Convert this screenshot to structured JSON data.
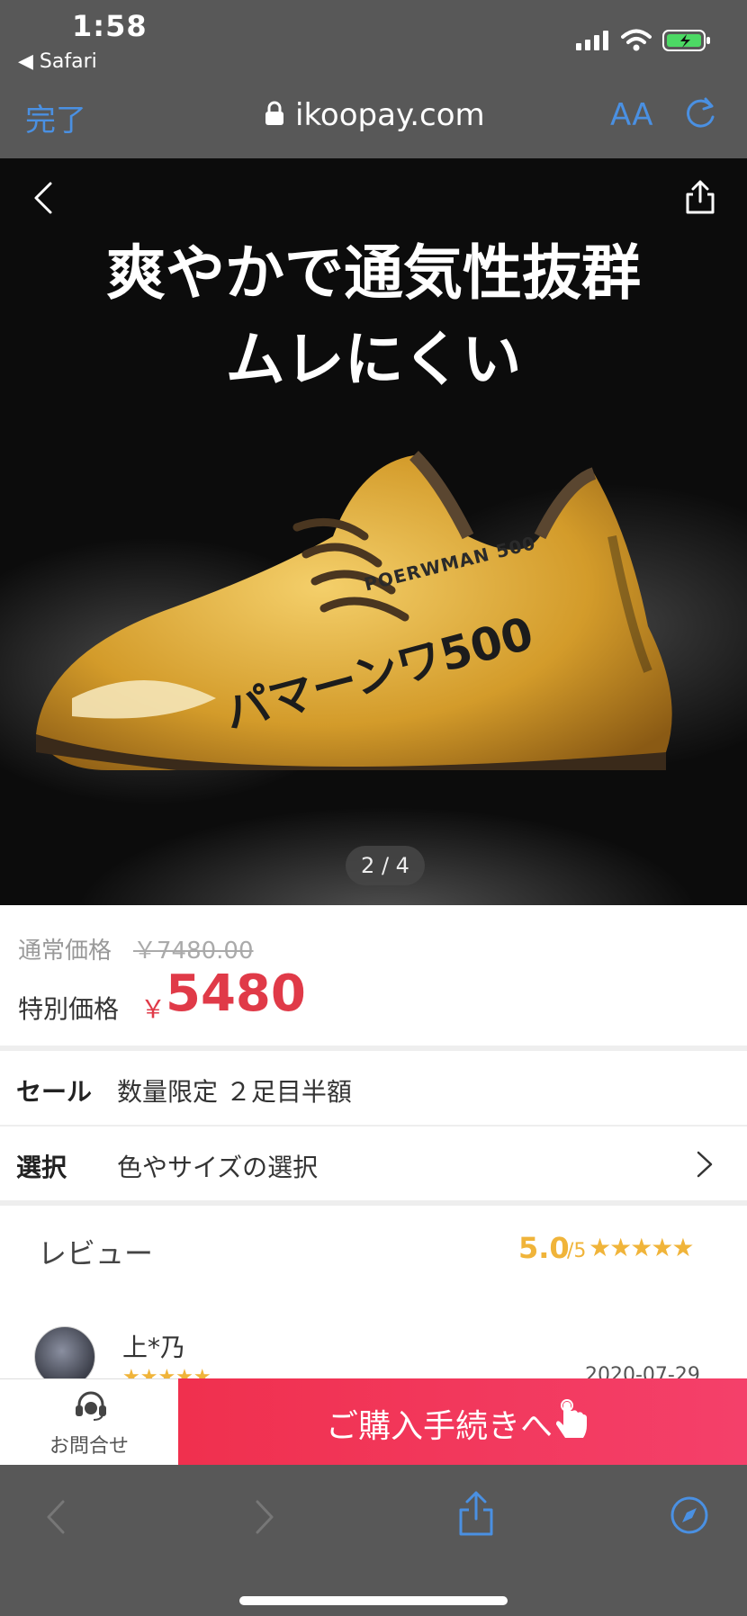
{
  "status": {
    "time": "1:58",
    "back_app": "◀ Safari"
  },
  "safari": {
    "done": "完了",
    "url": "ikoopay.com",
    "text_size": "AA"
  },
  "hero": {
    "headline_line1": "爽やかで通気性抜群",
    "headline_line2": "ムレにくい",
    "shoe_model": "POERWMAN 500",
    "shoe_name": "パマーンワ500",
    "counter": "2 / 4"
  },
  "price": {
    "regular_label": "通常価格",
    "regular_value": "￥7480.00",
    "special_label": "特別価格",
    "currency": "￥",
    "special_value": "5480"
  },
  "details": {
    "sale_key": "セール",
    "sale_value": "数量限定 ２足目半額",
    "select_key": "選択",
    "select_value": "色やサイズの選択"
  },
  "reviews": {
    "title": "レビュー",
    "rating": "5.0",
    "rating_max": "/5",
    "stars": "★★★★★",
    "items": [
      {
        "name": "上*乃",
        "stars": "★★★★★",
        "date": "2020-07-29"
      }
    ]
  },
  "buybar": {
    "contact_label": "お問合せ",
    "buy_label": "ご購入手続きへ"
  },
  "colors": {
    "accent_blue": "#4a90e2",
    "price_red": "#e03a48",
    "buy_red": "#f0304e",
    "star_gold": "#f0b43a"
  },
  "icons": [
    "signal-icon",
    "wifi-icon",
    "battery-icon",
    "lock-icon",
    "reload-icon",
    "back-chevron-icon",
    "share-icon",
    "chevron-right-icon",
    "headset-icon",
    "pointing-hand-icon",
    "compass-icon"
  ]
}
